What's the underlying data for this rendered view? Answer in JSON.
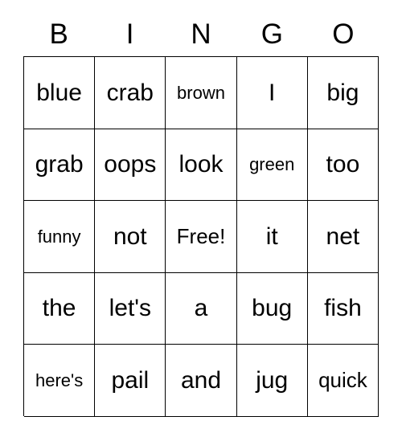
{
  "card": {
    "headers": [
      "B",
      "I",
      "N",
      "G",
      "O"
    ],
    "rows": [
      [
        {
          "text": "blue",
          "size": "normal"
        },
        {
          "text": "crab",
          "size": "normal"
        },
        {
          "text": "brown",
          "size": "small"
        },
        {
          "text": "I",
          "size": "normal"
        },
        {
          "text": "big",
          "size": "normal"
        }
      ],
      [
        {
          "text": "grab",
          "size": "normal"
        },
        {
          "text": "oops",
          "size": "normal"
        },
        {
          "text": "look",
          "size": "normal"
        },
        {
          "text": "green",
          "size": "small"
        },
        {
          "text": "too",
          "size": "normal"
        }
      ],
      [
        {
          "text": "funny",
          "size": "small"
        },
        {
          "text": "not",
          "size": "normal"
        },
        {
          "text": "Free!",
          "size": "mid"
        },
        {
          "text": "it",
          "size": "normal"
        },
        {
          "text": "net",
          "size": "normal"
        }
      ],
      [
        {
          "text": "the",
          "size": "normal"
        },
        {
          "text": "let's",
          "size": "normal"
        },
        {
          "text": "a",
          "size": "normal"
        },
        {
          "text": "bug",
          "size": "normal"
        },
        {
          "text": "fish",
          "size": "normal"
        }
      ],
      [
        {
          "text": "here's",
          "size": "small"
        },
        {
          "text": "pail",
          "size": "normal"
        },
        {
          "text": "and",
          "size": "normal"
        },
        {
          "text": "jug",
          "size": "normal"
        },
        {
          "text": "quick",
          "size": "mid"
        }
      ]
    ]
  },
  "colors": {
    "border": "#000000",
    "text": "#000000",
    "background": "#ffffff"
  }
}
